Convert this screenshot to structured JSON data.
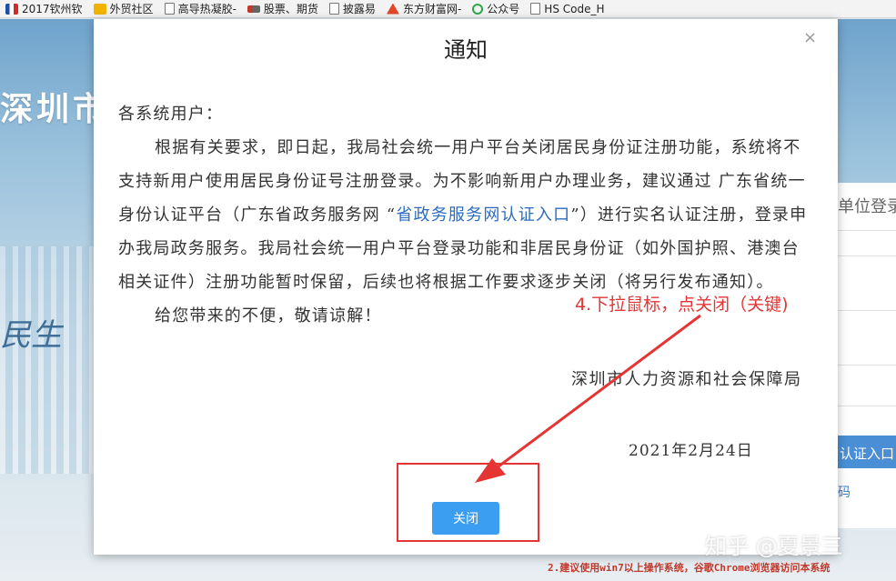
{
  "bookmarks": [
    {
      "label": "2017钦州钦",
      "icon": "flag-icon"
    },
    {
      "label": "外贸社区",
      "icon": "trade-icon"
    },
    {
      "label": "高导热凝胶-",
      "icon": "page-icon"
    },
    {
      "label": "股票、期货",
      "icon": "stock-icon"
    },
    {
      "label": "披露易",
      "icon": "page-icon"
    },
    {
      "label": "东方财富网-",
      "icon": "east-icon"
    },
    {
      "label": "公众号",
      "icon": "wechat-icon"
    },
    {
      "label": "HS Code_H",
      "icon": "page-icon"
    }
  ],
  "background": {
    "title": "深圳市",
    "slogan": "民生",
    "right_panel_heading": "单位登录",
    "right_panel_button": "认证入口",
    "right_panel_link": "码",
    "bottom_note": "2.建议使用win7以上操作系统，谷歌Chrome浏览器访问本系统"
  },
  "modal": {
    "title": "通知",
    "close_icon": "×",
    "greeting": "各系统用户：",
    "para1_a": "根据有关要求，即日起，我局社会统一用户平台关闭居民身份证注册功能，系统将不支持新用户使用居民身份证号注册登录。为不影响新用户办理业务，建议通过 广东省统一身份认证平台（广东省政务服务网 “",
    "para1_link": "省政务服务网认证入口",
    "para1_b": "”）进行实名认证注册，登录申办我局政务服务。我局社会统一用户平台登录功能和非居民身份证（如外国护照、港澳台相关证件）注册功能暂时保留，后续也将根据工作要求逐步关闭（将另行发布通知）。",
    "para2": "给您带来的不便，敬请谅解！",
    "signature": "深圳市人力资源和社会保障局",
    "date": "2021年2月24日",
    "close_button": "关闭"
  },
  "annotation": {
    "text": "4.下拉鼠标，点关闭（关键)",
    "color": "#e53434"
  },
  "watermark": "知乎 @夏景三"
}
